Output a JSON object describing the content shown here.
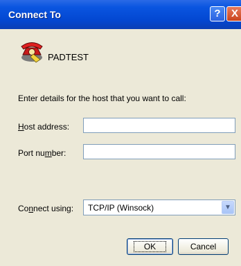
{
  "window": {
    "title": "Connect To",
    "help_button": "?",
    "close_button": "X"
  },
  "connection": {
    "name": "PADTEST",
    "icon": "red-telephone-icon"
  },
  "instructions": "Enter details for the host that you want to call:",
  "fields": {
    "host": {
      "label_accel": "H",
      "label_rest": "ost address:",
      "value": ""
    },
    "port": {
      "label_pre": "Port nu",
      "label_accel": "m",
      "label_post": "ber:",
      "value": ""
    }
  },
  "connect_using": {
    "label_pre": "Co",
    "label_accel": "n",
    "label_post": "nect using:",
    "selected": "TCP/IP (Winsock)"
  },
  "buttons": {
    "ok": "OK",
    "cancel": "Cancel"
  },
  "colors": {
    "title_bar": "#0a55e0",
    "dialog_bg": "#ece9d8",
    "field_border": "#7f9db9"
  }
}
